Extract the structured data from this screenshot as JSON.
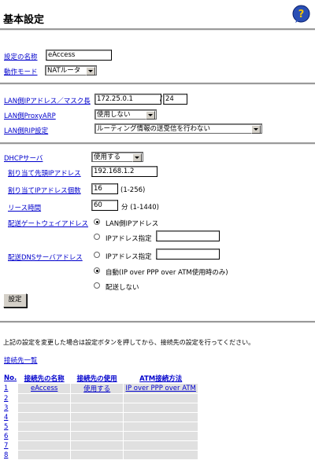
{
  "page": {
    "title": "基本設定"
  },
  "form": {
    "config_name_label": "設定の名称",
    "config_name_value": "eAccess",
    "mode_label": "動作モード",
    "mode_value": "NATルータ",
    "lan_ip_label": "LAN側IPアドレス／マスク長",
    "lan_ip_value": "172.25.0.1",
    "mask_sep": "/",
    "mask_value": "24",
    "proxy_arp_label": "LAN側ProxyARP",
    "proxy_arp_value": "使用しない",
    "rip_label": "LAN側RIP設定",
    "rip_value": "ルーティング情報の送受信を行わない",
    "dhcp_label": "DHCPサーバ",
    "dhcp_value": "使用する",
    "dhcp_start_label": "割り当て先頭IPアドレス",
    "dhcp_start_value": "192.168.1.2",
    "dhcp_count_label": "割り当てIPアドレス個数",
    "dhcp_count_value": "16",
    "dhcp_count_range": "(1-256)",
    "lease_label": "リース時間",
    "lease_value": "60",
    "lease_unit": "分 (1-1440)",
    "gw_label": "配送ゲートウェイアドレス",
    "gw_opt_lan": "LAN側IPアドレス",
    "gw_opt_ip": "IPアドレス指定",
    "gw_ip_value": "",
    "dns_label": "配送DNSサーバアドレス",
    "dns_opt_ip": "IPアドレス指定",
    "dns_ip_value": "",
    "dns_opt_auto": "自動(IP over PPP over ATM使用時のみ)",
    "dns_opt_none": "配送しない",
    "submit_label": "設定"
  },
  "note": "上記の設定を変更した場合は設定ボタンを押してから、接続先の設定を行ってください。",
  "connection_list_link": "接続先一覧",
  "table": {
    "headers": [
      "No.",
      "接続先の名称",
      "接続先の使用",
      "ATM接続方法"
    ],
    "rows": [
      [
        "1",
        "eAccess",
        "使用する",
        "IP over PPP over ATM"
      ],
      [
        "2",
        "",
        "",
        ""
      ],
      [
        "3",
        "",
        "",
        ""
      ],
      [
        "4",
        "",
        "",
        ""
      ],
      [
        "5",
        "",
        "",
        ""
      ],
      [
        "6",
        "",
        "",
        ""
      ],
      [
        "7",
        "",
        "",
        ""
      ],
      [
        "8",
        "",
        "",
        ""
      ]
    ]
  },
  "colors": {
    "link": "#0000cc",
    "table_cell_bg": "#e0e0e0",
    "separator": "#9a9a9a"
  },
  "icons": {
    "help": "help-icon"
  }
}
